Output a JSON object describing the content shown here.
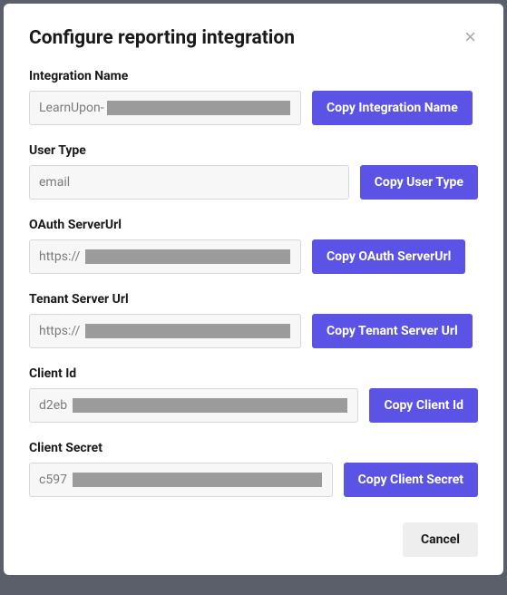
{
  "modal": {
    "title": "Configure reporting integration",
    "fields": [
      {
        "label": "Integration Name",
        "value": "LearnUpon-",
        "copyLabel": "Copy Integration Name",
        "redactLeft": 86,
        "redactRight": 12
      },
      {
        "label": "User Type",
        "value": "email",
        "copyLabel": "Copy User Type",
        "redactLeft": 0,
        "redactRight": 0
      },
      {
        "label": "OAuth ServerUrl",
        "value": "https://",
        "copyLabel": "Copy OAuth ServerUrl",
        "redactLeft": 62,
        "redactRight": 12
      },
      {
        "label": "Tenant Server Url",
        "value": "https://",
        "copyLabel": "Copy Tenant Server Url",
        "redactLeft": 62,
        "redactRight": 12
      },
      {
        "label": "Client Id",
        "value": "d2eb",
        "copyLabel": "Copy Client Id",
        "redactLeft": 48,
        "redactRight": 12
      },
      {
        "label": "Client Secret",
        "value": "c597",
        "copyLabel": "Copy Client Secret",
        "redactLeft": 48,
        "redactRight": 12
      }
    ],
    "cancelLabel": "Cancel"
  }
}
